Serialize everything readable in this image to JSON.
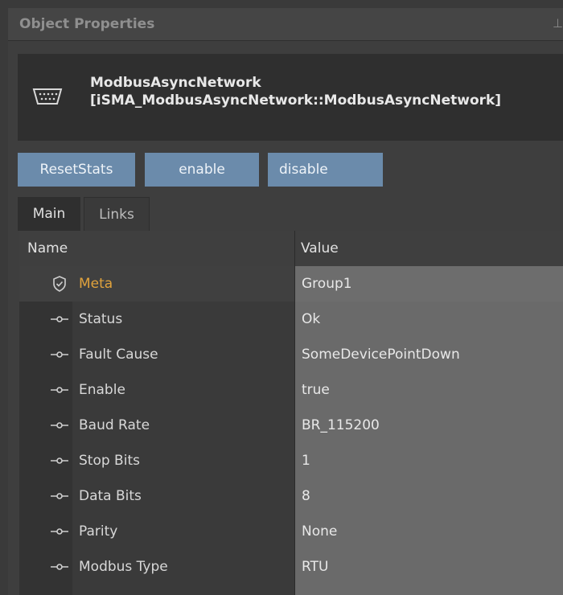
{
  "panel": {
    "title": "Object Properties",
    "pin_icon": "pin-icon"
  },
  "object": {
    "name_line1": "ModbusAsyncNetwork",
    "name_line2": "[iSMA_ModbusAsyncNetwork::ModbusAsyncNetwork]",
    "icon": "serial-port-icon"
  },
  "actions": [
    {
      "label": "ResetStats"
    },
    {
      "label": "enable"
    },
    {
      "label": "disable"
    }
  ],
  "tabs": [
    {
      "label": "Main",
      "active": true
    },
    {
      "label": "Links",
      "active": false
    }
  ],
  "grid": {
    "col_name": "Name",
    "col_value": "Value",
    "rows": [
      {
        "icon": "shield-icon",
        "name": "Meta",
        "value": "Group1"
      },
      {
        "icon": "slot-icon",
        "name": "Status",
        "value": "Ok"
      },
      {
        "icon": "slot-icon",
        "name": "Fault Cause",
        "value": "SomeDevicePointDown"
      },
      {
        "icon": "slot-icon",
        "name": "Enable",
        "value": "true"
      },
      {
        "icon": "slot-icon",
        "name": "Baud Rate",
        "value": "BR_115200"
      },
      {
        "icon": "slot-icon",
        "name": "Stop Bits",
        "value": "1"
      },
      {
        "icon": "slot-icon",
        "name": "Data Bits",
        "value": "8"
      },
      {
        "icon": "slot-icon",
        "name": "Parity",
        "value": "None"
      },
      {
        "icon": "slot-icon",
        "name": "Modbus Type",
        "value": "RTU"
      }
    ]
  },
  "colors": {
    "accent_button": "#6b8bab",
    "meta_label": "#e0a23c"
  }
}
